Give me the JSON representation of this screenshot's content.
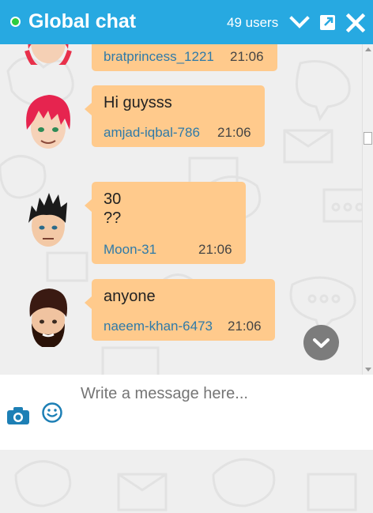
{
  "header": {
    "title": "Global chat",
    "users": "49 users",
    "accent": "#27a9e1"
  },
  "messages": [
    {
      "text": "",
      "author": "bratprincess_1221",
      "time": "21:06",
      "avatar": "red-hair-girl-avatar"
    },
    {
      "text": "Hi guysss",
      "author": "amjad-iqbal-786",
      "time": "21:06",
      "avatar": "red-hair-boy-avatar"
    },
    {
      "text": "30\n??",
      "author": "Moon-31",
      "time": "21:06",
      "avatar": "spiky-black-hair-avatar"
    },
    {
      "text": "anyone",
      "author": "naeem-khan-6473",
      "time": "21:06",
      "avatar": "bearded-man-avatar"
    }
  ],
  "composer": {
    "placeholder": "Write a message here..."
  },
  "colors": {
    "bubble": "#ffca8c",
    "author": "#2f7aa8"
  }
}
